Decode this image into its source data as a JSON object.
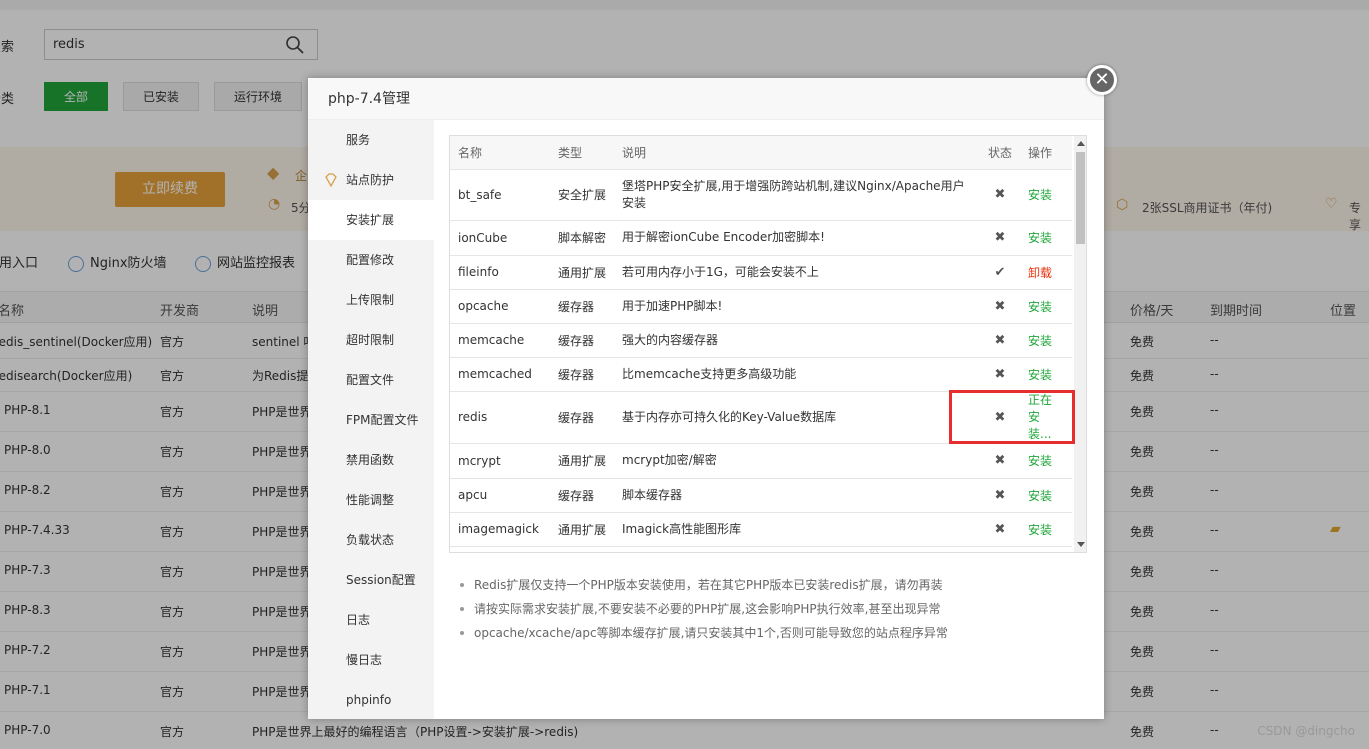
{
  "search": {
    "label": "搜索",
    "value": "redis"
  },
  "categories": {
    "label": "分类",
    "items": [
      {
        "label": "全部",
        "active": true
      },
      {
        "label": "已安装",
        "active": false
      },
      {
        "label": "运行环境",
        "active": false
      }
    ]
  },
  "banner": {
    "renew_button": "立即续费",
    "text_partial": "5分",
    "text_partial_2": "企",
    "ssl_text": "2张SSL商用证书（年付)",
    "exclusive_text": "专享"
  },
  "quicklinks": [
    "使用入口",
    "Nginx防火墙",
    "网站监控报表"
  ],
  "bg_table": {
    "headers": [
      "名称",
      "开发商",
      "说明",
      "价格/天",
      "到期时间",
      "位置"
    ],
    "rows": [
      {
        "name": "redis_sentinel(Docker应用)",
        "dev": "官方",
        "desc": "sentinel 哨",
        "price": "免费",
        "expire": "--"
      },
      {
        "name": "redisearch(Docker应用)",
        "dev": "官方",
        "desc": "为Redis提",
        "price": "免费",
        "expire": "--"
      },
      {
        "name": "PHP-8.1",
        "dev": "官方",
        "desc": "PHP是世界",
        "price": "免费",
        "expire": "--"
      },
      {
        "name": "PHP-8.0",
        "dev": "官方",
        "desc": "PHP是世界",
        "price": "免费",
        "expire": "--"
      },
      {
        "name": "PHP-8.2",
        "dev": "官方",
        "desc": "PHP是世界",
        "price": "免费",
        "expire": "--"
      },
      {
        "name": "PHP-7.4.33",
        "dev": "官方",
        "desc": "PHP是世界",
        "price": "免费",
        "expire": "--"
      },
      {
        "name": "PHP-7.3",
        "dev": "官方",
        "desc": "PHP是世界",
        "price": "免费",
        "expire": "--"
      },
      {
        "name": "PHP-8.3",
        "dev": "官方",
        "desc": "PHP是世界",
        "price": "免费",
        "expire": "--"
      },
      {
        "name": "PHP-7.2",
        "dev": "官方",
        "desc": "PHP是世界",
        "price": "免费",
        "expire": "--"
      },
      {
        "name": "PHP-7.1",
        "dev": "官方",
        "desc": "PHP是世界",
        "price": "免费",
        "expire": "--"
      },
      {
        "name": "PHP-7.0",
        "dev": "官方",
        "desc": "PHP是世界上最好的编程语言",
        "desc_link": "（PHP设置->安装扩展->redis)",
        "price": "免费",
        "expire": "--"
      }
    ]
  },
  "modal": {
    "title": "php-7.4管理",
    "close_glyph": "✕",
    "sidebar": [
      "服务",
      "站点防护",
      "安装扩展",
      "配置修改",
      "上传限制",
      "超时限制",
      "配置文件",
      "FPM配置文件",
      "禁用函数",
      "性能调整",
      "负载状态",
      "Session配置",
      "日志",
      "慢日志",
      "phpinfo"
    ],
    "active_sidebar_index": 2,
    "table": {
      "headers": [
        "名称",
        "类型",
        "说明",
        "状态",
        "操作"
      ],
      "rows": [
        {
          "name": "bt_safe",
          "type": "安全扩展",
          "desc": "堡塔PHP安全扩展,用于增强防跨站机制,建议Nginx/Apache用户安装",
          "status": "✖",
          "op": "安装",
          "op_kind": "install"
        },
        {
          "name": "ionCube",
          "type": "脚本解密",
          "desc": "用于解密ionCube Encoder加密脚本!",
          "status": "✖",
          "op": "安装",
          "op_kind": "install"
        },
        {
          "name": "fileinfo",
          "type": "通用扩展",
          "desc": "若可用内存小于1G，可能会安装不上",
          "status": "✔",
          "op": "卸载",
          "op_kind": "uninstall"
        },
        {
          "name": "opcache",
          "type": "缓存器",
          "desc": "用于加速PHP脚本!",
          "status": "✖",
          "op": "安装",
          "op_kind": "install"
        },
        {
          "name": "memcache",
          "type": "缓存器",
          "desc": "强大的内容缓存器",
          "status": "✖",
          "op": "安装",
          "op_kind": "install"
        },
        {
          "name": "memcached",
          "type": "缓存器",
          "desc": "比memcache支持更多高级功能",
          "status": "✖",
          "op": "安装",
          "op_kind": "install"
        },
        {
          "name": "redis",
          "type": "缓存器",
          "desc": "基于内存亦可持久化的Key-Value数据库",
          "status": "✖",
          "op": "正在安装...",
          "op_kind": "install"
        },
        {
          "name": "mcrypt",
          "type": "通用扩展",
          "desc": "mcrypt加密/解密",
          "status": "✖",
          "op": "安装",
          "op_kind": "install"
        },
        {
          "name": "apcu",
          "type": "缓存器",
          "desc": "脚本缓存器",
          "status": "✖",
          "op": "安装",
          "op_kind": "install"
        },
        {
          "name": "imagemagick",
          "type": "通用扩展",
          "desc": "Imagick高性能图形库",
          "status": "✖",
          "op": "安装",
          "op_kind": "install"
        }
      ]
    },
    "tips": [
      "Redis扩展仅支持一个PHP版本安装使用，若在其它PHP版本已安装redis扩展，请勿再装",
      "请按实际需求安装扩展,不要安装不必要的PHP扩展,这会影响PHP执行效率,甚至出现异常",
      "opcache/xcache/apc等脚本缓存扩展,请只安装其中1个,否则可能导致您的站点程序异常"
    ]
  },
  "watermark": "CSDN @dingcho",
  "colors": {
    "accent_green": "#20a53a",
    "danger_red": "#e8300b",
    "highlight_red": "#e62e2e"
  }
}
